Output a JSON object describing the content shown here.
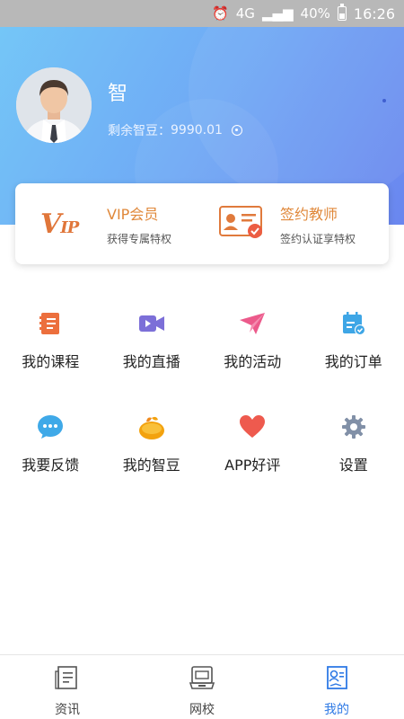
{
  "status_bar": {
    "battery": "40%",
    "time": "16:26",
    "network": "4G"
  },
  "profile": {
    "name": "智",
    "beans_label": "剩余智豆：",
    "beans_value": "9990.01"
  },
  "membership": [
    {
      "title": "VIP会员",
      "subtitle": "获得专属特权",
      "icon": "vip-logo"
    },
    {
      "title": "签约教师",
      "subtitle": "签约认证享特权",
      "icon": "certificate-icon"
    }
  ],
  "menu_row1": [
    {
      "label": "我的课程",
      "icon": "book-icon",
      "color": "#e96a3c"
    },
    {
      "label": "我的直播",
      "icon": "video-icon",
      "color": "#7b6fd6"
    },
    {
      "label": "我的活动",
      "icon": "paper-plane-icon",
      "color": "#e9568a"
    },
    {
      "label": "我的订单",
      "icon": "calendar-check-icon",
      "color": "#3ea6e6"
    }
  ],
  "menu_row2": [
    {
      "label": "我要反馈",
      "icon": "chat-bubble-icon",
      "color": "#3fa9e8"
    },
    {
      "label": "我的智豆",
      "icon": "bean-icon",
      "color": "#f2a20c"
    },
    {
      "label": "APP好评",
      "icon": "heart-icon",
      "color": "#ee5a4e"
    },
    {
      "label": "设置",
      "icon": "gear-icon",
      "color": "#8190a7"
    }
  ],
  "bottom_nav": [
    {
      "label": "资讯",
      "icon": "news-icon",
      "active": false
    },
    {
      "label": "网校",
      "icon": "school-icon",
      "active": false
    },
    {
      "label": "我的",
      "icon": "profile-icon",
      "active": true
    }
  ],
  "colors": {
    "accent": "#2f7ae5",
    "header_start": "#74c6f7",
    "header_end": "#6a86ef",
    "member_orange": "#e0883a"
  }
}
